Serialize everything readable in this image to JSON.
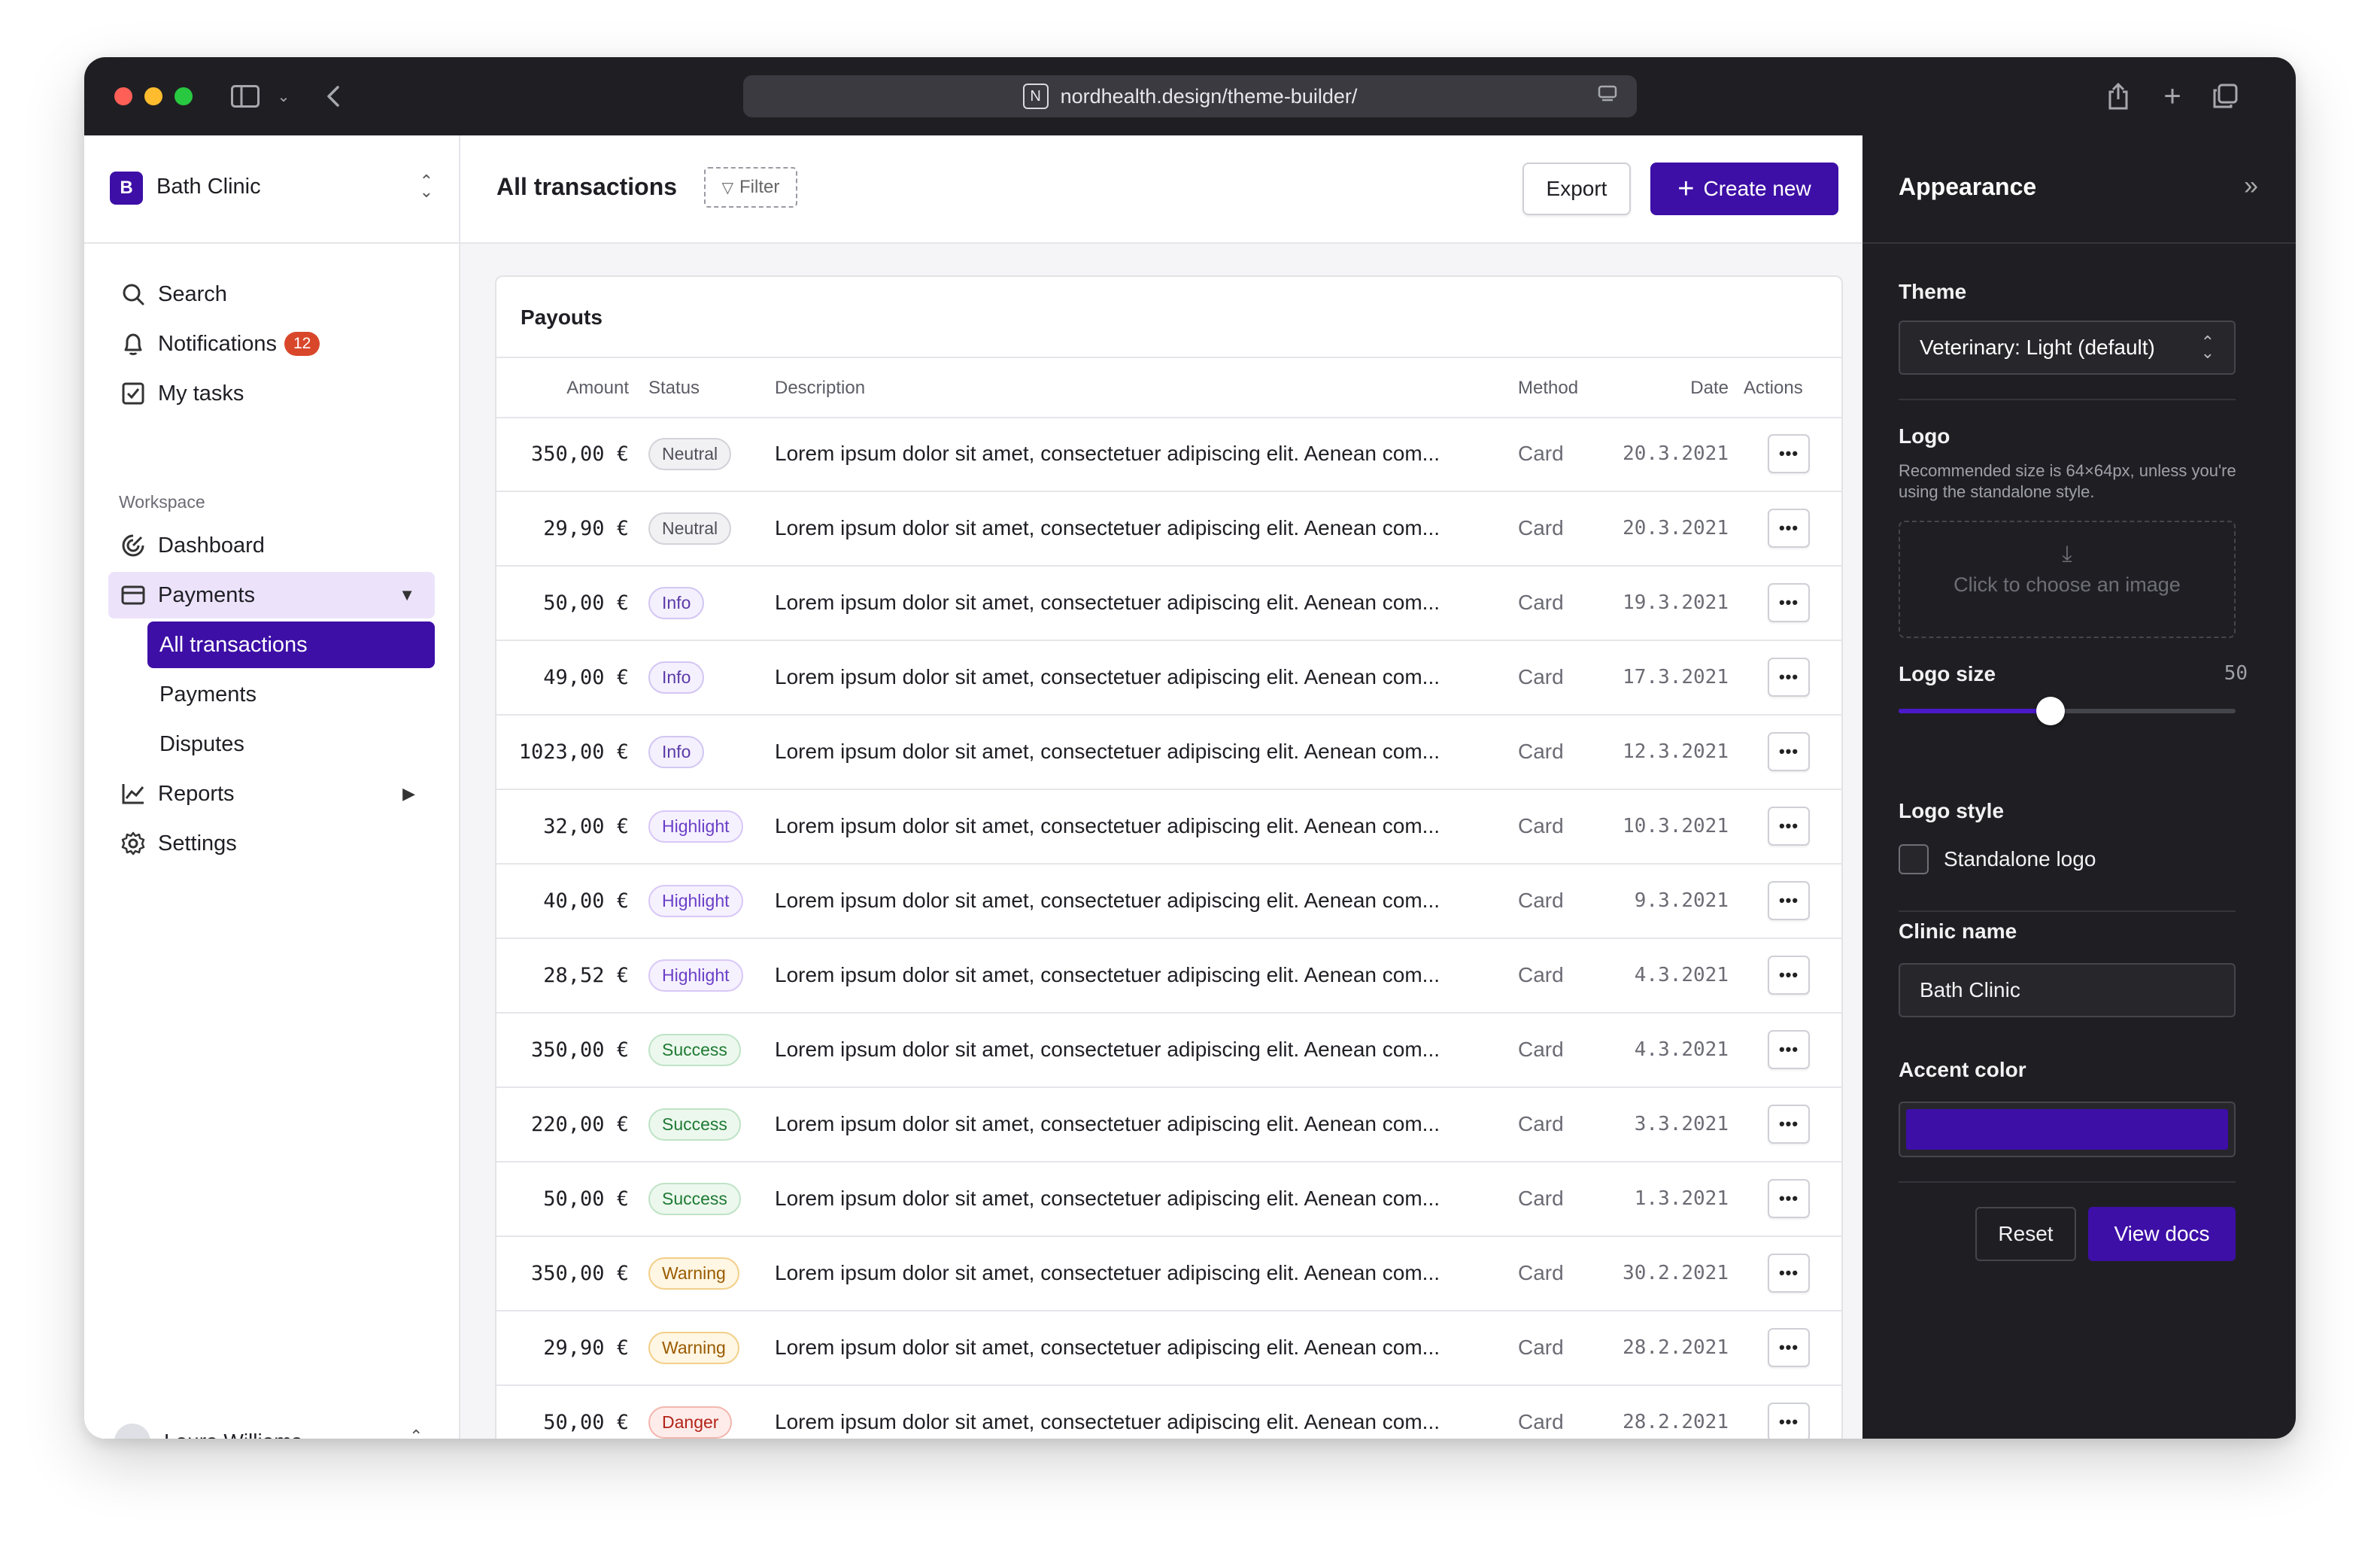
{
  "browser": {
    "url": "nordhealth.design/theme-builder/"
  },
  "sidebar": {
    "org_initial": "B",
    "org_name": "Bath Clinic",
    "nav_top": [
      {
        "label": "Search",
        "icon": "search-icon"
      },
      {
        "label": "Notifications",
        "icon": "bell-icon",
        "badge": "12"
      },
      {
        "label": "My tasks",
        "icon": "checkbox-icon"
      }
    ],
    "section_label": "Workspace",
    "nav_workspace": {
      "dashboard": "Dashboard",
      "payments": "Payments",
      "all_transactions": "All transactions",
      "payments_sub": "Payments",
      "disputes": "Disputes",
      "reports": "Reports",
      "settings": "Settings"
    },
    "user_name": "Laura Williams"
  },
  "header": {
    "title": "All transactions",
    "filter_label": "Filter",
    "export_label": "Export",
    "create_label": "Create new"
  },
  "table": {
    "title": "Payouts",
    "columns": {
      "amount": "Amount",
      "status": "Status",
      "description": "Description",
      "method": "Method",
      "date": "Date",
      "actions": "Actions"
    },
    "rows": [
      {
        "amount": "350,00 €",
        "status": "Neutral",
        "variant": "neutral",
        "description": "Lorem ipsum dolor sit amet, consectetuer adipiscing elit. Aenean com...",
        "method": "Card",
        "date": "20.3.2021"
      },
      {
        "amount": "29,90 €",
        "status": "Neutral",
        "variant": "neutral",
        "description": "Lorem ipsum dolor sit amet, consectetuer adipiscing elit. Aenean com...",
        "method": "Card",
        "date": "20.3.2021"
      },
      {
        "amount": "50,00 €",
        "status": "Info",
        "variant": "info",
        "description": "Lorem ipsum dolor sit amet, consectetuer adipiscing elit. Aenean com...",
        "method": "Card",
        "date": "19.3.2021"
      },
      {
        "amount": "49,00 €",
        "status": "Info",
        "variant": "info",
        "description": "Lorem ipsum dolor sit amet, consectetuer adipiscing elit. Aenean com...",
        "method": "Card",
        "date": "17.3.2021"
      },
      {
        "amount": "1023,00 €",
        "status": "Info",
        "variant": "info",
        "description": "Lorem ipsum dolor sit amet, consectetuer adipiscing elit. Aenean com...",
        "method": "Card",
        "date": "12.3.2021"
      },
      {
        "amount": "32,00 €",
        "status": "Highlight",
        "variant": "highlight",
        "description": "Lorem ipsum dolor sit amet, consectetuer adipiscing elit. Aenean com...",
        "method": "Card",
        "date": "10.3.2021"
      },
      {
        "amount": "40,00 €",
        "status": "Highlight",
        "variant": "highlight",
        "description": "Lorem ipsum dolor sit amet, consectetuer adipiscing elit. Aenean com...",
        "method": "Card",
        "date": "9.3.2021"
      },
      {
        "amount": "28,52 €",
        "status": "Highlight",
        "variant": "highlight",
        "description": "Lorem ipsum dolor sit amet, consectetuer adipiscing elit. Aenean com...",
        "method": "Card",
        "date": "4.3.2021"
      },
      {
        "amount": "350,00 €",
        "status": "Success",
        "variant": "success",
        "description": "Lorem ipsum dolor sit amet, consectetuer adipiscing elit. Aenean com...",
        "method": "Card",
        "date": "4.3.2021"
      },
      {
        "amount": "220,00 €",
        "status": "Success",
        "variant": "success",
        "description": "Lorem ipsum dolor sit amet, consectetuer adipiscing elit. Aenean com...",
        "method": "Card",
        "date": "3.3.2021"
      },
      {
        "amount": "50,00 €",
        "status": "Success",
        "variant": "success",
        "description": "Lorem ipsum dolor sit amet, consectetuer adipiscing elit. Aenean com...",
        "method": "Card",
        "date": "1.3.2021"
      },
      {
        "amount": "350,00 €",
        "status": "Warning",
        "variant": "warning",
        "description": "Lorem ipsum dolor sit amet, consectetuer adipiscing elit. Aenean com...",
        "method": "Card",
        "date": "30.2.2021"
      },
      {
        "amount": "29,90 €",
        "status": "Warning",
        "variant": "warning",
        "description": "Lorem ipsum dolor sit amet, consectetuer adipiscing elit. Aenean com...",
        "method": "Card",
        "date": "28.2.2021"
      },
      {
        "amount": "50,00 €",
        "status": "Danger",
        "variant": "danger",
        "description": "Lorem ipsum dolor sit amet, consectetuer adipiscing elit. Aenean com...",
        "method": "Card",
        "date": "28.2.2021"
      }
    ]
  },
  "appearance": {
    "title": "Appearance",
    "theme_label": "Theme",
    "theme_value": "Veterinary: Light (default)",
    "logo_label": "Logo",
    "logo_help": "Recommended size is 64×64px, unless you're using the standalone style.",
    "logo_dropzone": "Click to choose an image",
    "logo_size_label": "Logo size",
    "logo_size_value": "50",
    "logo_size_fraction": 0.45,
    "logo_style_label": "Logo style",
    "standalone_label": "Standalone logo",
    "standalone_checked": false,
    "clinic_name_label": "Clinic name",
    "clinic_name_value": "Bath Clinic",
    "accent_label": "Accent color",
    "accent_color": "#3d0fa6",
    "reset_label": "Reset",
    "docs_label": "View docs"
  }
}
